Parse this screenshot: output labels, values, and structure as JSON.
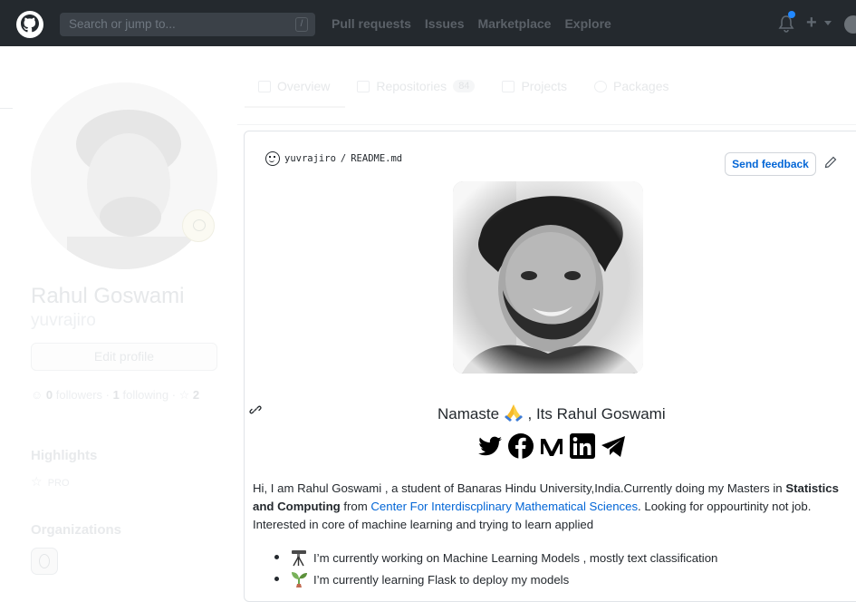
{
  "header": {
    "search_placeholder": "Search or jump to...",
    "search_key": "/",
    "nav": [
      "Pull requests",
      "Issues",
      "Marketplace",
      "Explore"
    ],
    "icons": [
      "github-logo-icon",
      "bell-icon",
      "plus-icon",
      "caret-down-icon",
      "avatar-icon"
    ]
  },
  "sidebar": {
    "full_name": "Rahul Goswami",
    "username": "yuvrajiro",
    "edit_profile_label": "Edit profile",
    "followers_count": "0",
    "followers_label": "followers",
    "following_count": "1",
    "following_label": "following",
    "stars_count": "2",
    "highlights_title": "Highlights",
    "pro_badge": "PRO",
    "organizations_title": "Organizations"
  },
  "tabs": [
    {
      "label": "Overview",
      "icon": "book-icon"
    },
    {
      "label": "Repositories",
      "count": "84",
      "icon": "repo-icon"
    },
    {
      "label": "Projects",
      "icon": "project-icon"
    },
    {
      "label": "Packages",
      "icon": "package-icon"
    }
  ],
  "readme": {
    "owner": "yuvrajiro",
    "separator": "/",
    "file": "README.md",
    "feedback_label": "Send feedback",
    "greeting_before": "Namaste",
    "greeting_after": ", Its Rahul Goswami",
    "social_icons": [
      "twitter-icon",
      "facebook-icon",
      "medium-icon",
      "linkedin-icon",
      "telegram-icon"
    ],
    "bio_part1": "Hi, I am Rahul Goswami , a student of Banaras Hindu University,India.Currently doing my Masters in ",
    "bio_bold": "Statistics and Computing",
    "bio_part2": " from ",
    "bio_link": "Center For Interdiscplinary Mathematical Sciences",
    "bio_part3": ". Looking for oppourtinity not job. Interested in core of machine learning and trying to learn applied",
    "list": [
      {
        "icon": "telescope-icon",
        "text": "I’m currently working on Machine Learning Models , mostly text classification"
      },
      {
        "icon": "seedling-icon",
        "text": "I’m currently learning Flask to deploy my models"
      }
    ]
  },
  "colors": {
    "header_bg": "#24292e",
    "link": "#0366d6",
    "text": "#24292e",
    "border": "#e1e4e8"
  }
}
